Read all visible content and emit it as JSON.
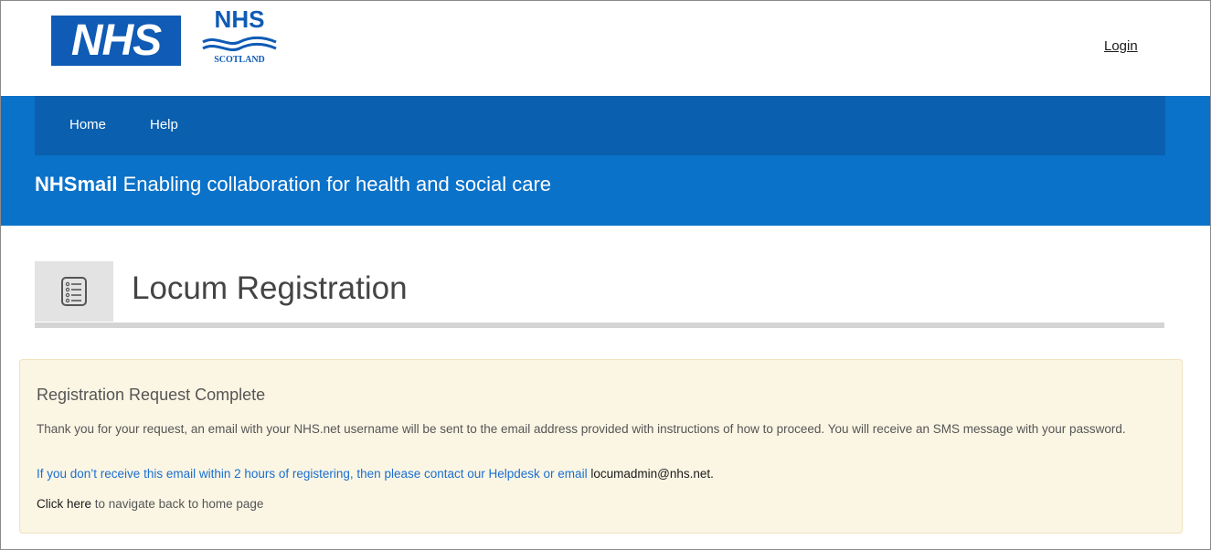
{
  "header": {
    "nhs_logo_text": "NHS",
    "scotland_logo_nhs": "NHS",
    "scotland_logo_name": "SCOTLAND",
    "login_label": "Login"
  },
  "nav": {
    "items": [
      {
        "label": "Home"
      },
      {
        "label": "Help"
      }
    ]
  },
  "tagline": {
    "brand": "NHSmail",
    "text": "Enabling collaboration for health and social care"
  },
  "page": {
    "title": "Locum Registration",
    "icon": "list-icon"
  },
  "alert": {
    "title": "Registration Request Complete",
    "body": "Thank you for your request, an email with your NHS.net username will be sent to the email address provided with instructions of how to proceed. You will receive an SMS message with your password.",
    "contact_text": "If you don’t receive this email within 2 hours of registering, then please contact our Helpdesk or email ",
    "contact_email": "locumadmin@nhs.net.",
    "home_link": "Click here",
    "home_text": " to navigate back to home page"
  },
  "colors": {
    "nhs_blue": "#0f5bb5",
    "band_blue": "#0b72c9",
    "nav_blue": "#0a5fae",
    "alert_bg": "#fbf6e4",
    "link_blue": "#1a6ed1"
  }
}
